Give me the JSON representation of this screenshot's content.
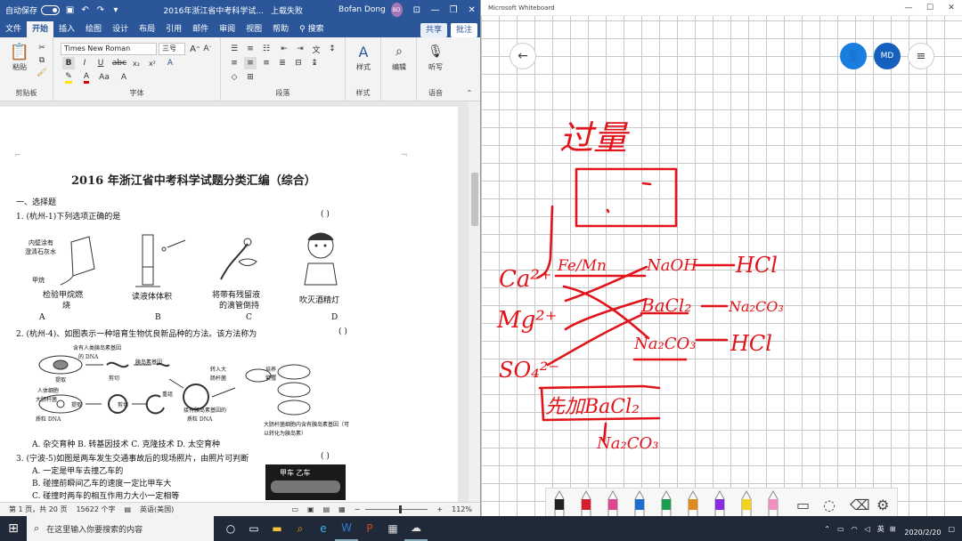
{
  "word": {
    "titlebar": {
      "autosave_label": "自动保存",
      "autosave_state": "关",
      "title": "2016年浙江省中考科学试...",
      "upload_status": "上载失败",
      "user_name": "Bofan Dong",
      "user_initials": "BD"
    },
    "tabs": [
      "文件",
      "开始",
      "插入",
      "绘图",
      "设计",
      "布局",
      "引用",
      "邮件",
      "审阅",
      "视图",
      "帮助"
    ],
    "active_tab": "开始",
    "tell_me": "搜索",
    "share_label": "共享",
    "comment_label": "批注",
    "ribbon": {
      "paste_label": "粘贴",
      "clipboard_group": "剪贴板",
      "font_name": "Times New Roman",
      "font_size": "三号",
      "font_group": "字体",
      "paragraph_group": "段落",
      "styles_label": "样式",
      "styles_group": "样式",
      "editing_label": "编辑",
      "dictate_label": "听写",
      "voice_group": "语音"
    },
    "document": {
      "title": "2016 年浙江省中考科学试题分类汇编（综合）",
      "section1": "一、选择题",
      "q1": "1. (杭州-1)下列选项正确的是",
      "q1_paren": "(         )",
      "q1_labels": {
        "a1": "内壁涂有",
        "a2": "澄清石灰水",
        "a3": "甲烷",
        "a_caption1": "检验甲烷燃",
        "a_caption2": "烧",
        "b_caption": "读液体体积",
        "c_caption1": "将带有残留液",
        "c_caption2": "的滴管倒持",
        "d_caption": "吹灭酒精灯"
      },
      "q1_options": [
        "A",
        "B",
        "C",
        "D"
      ],
      "q2": "2. (杭州-4)、如图表示一种培育生物优良新品种的方法。该方法称为",
      "q2_paren": "(         )",
      "q2_labels": {
        "l1": "含有人类胰岛素基因",
        "l2": "的 DNA",
        "l3": "提取",
        "l4": "人体细胞",
        "l5": "胰岛素基因",
        "l6": "剪切",
        "l7": "转入大",
        "l8": "肠杆菌",
        "l9": "培养",
        "l10": "繁殖",
        "l11": "重组",
        "l12": "大肠杆菌",
        "l13": "质粒 DNA",
        "l14": "提取",
        "l15": "剪切",
        "l16": "接有胰岛素基因的",
        "l17": "质粒 DNA",
        "l18": "大肠杆菌细胞内含有胰岛素基因（可",
        "l19": "以转化为胰岛素）"
      },
      "q2_options": "A.  杂交育种       B.  转基因技术       C.  克隆技术       D.  太空育种",
      "q3": "3. (宁波-5)如图是两车发生交通事故后的现场照片，由照片可判断",
      "q3_paren": "(         )",
      "q3_a": "A.   一定是甲车去撞乙车的",
      "q3_b": "B.   碰撞前瞬间乙车的速度一定比甲车大",
      "q3_c": "C.   碰撞时两车的相互作用力大小一定相等",
      "q3_photo": "甲车    乙车"
    },
    "status": {
      "page": "第 1 页，共 20 页",
      "words": "15622 个字",
      "language": "英语(美国)",
      "zoom": "112%"
    }
  },
  "whiteboard": {
    "title": "Microsoft Whiteboard",
    "avatar_initials": "MD",
    "ink": {
      "heading": "过量",
      "left_ions": [
        "Ca²⁺",
        "Mg²⁺",
        "SO₄²⁻"
      ],
      "col1": "Fe/Mn",
      "col2": [
        "NaOH",
        "BaCl₂",
        "Na₂CO₃"
      ],
      "col3": [
        "HCl",
        "Na₂CO₃",
        "HCl"
      ],
      "bottom1": "先加BaCl₂",
      "bottom2": "Na₂CO₃"
    },
    "pen_colors": [
      "#222222",
      "#d61b2b",
      "#e0458f",
      "#1c6fd1",
      "#1b9e4b",
      "#e08a1e",
      "#8a2be2",
      "#f2d21c",
      "#f08fc0"
    ]
  },
  "taskbar": {
    "search_placeholder": "在这里输入你要搜索的内容",
    "ime": "英",
    "date": "2020/2/20"
  }
}
